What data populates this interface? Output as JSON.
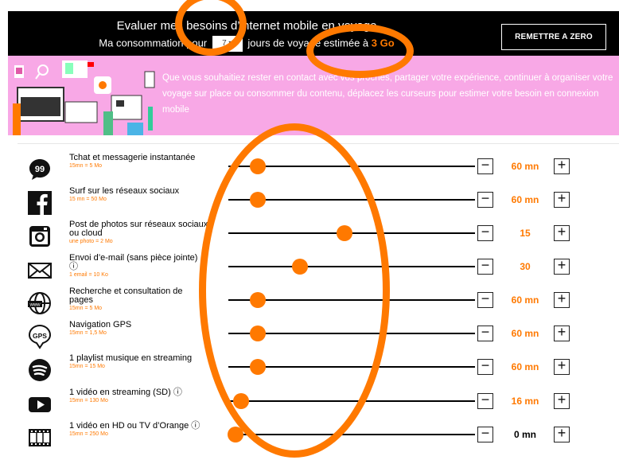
{
  "header": {
    "title": "Evaluer mes besoins d’internet mobile en voyage",
    "line_prefix": "Ma consommation pour",
    "days_value": "7",
    "line_middle": "jours de voyage estimée à",
    "total": "3 Go",
    "reset_label": "REMETTRE A ZERO"
  },
  "intro": {
    "text": "Que vous souhaitiez rester en contact avec vos proches, partager votre expérience, continuer à organiser votre voyage sur place ou consommer du contenu, déplacez les curseurs pour estimer votre besoin en connexion mobile"
  },
  "rows": [
    {
      "icon": "chat-bubble-icon",
      "label": "Tchat et messagerie instantanée",
      "sub": "15mn = 5 Mo",
      "value": "60 mn",
      "level": 0.12
    },
    {
      "icon": "facebook-icon",
      "label": "Surf sur les réseaux sociaux",
      "sub": "15 mn = 50 Mo",
      "value": "60 mn",
      "level": 0.12
    },
    {
      "icon": "instagram-icon",
      "label": "Post de photos sur réseaux sociaux ou cloud",
      "sub": "une photo = 2 Mo",
      "value": "15",
      "level": 0.47
    },
    {
      "icon": "envelope-icon",
      "label": "Envoi d’e-mail (sans pièce jointe) ⓘ",
      "sub": "1 email = 10 Ko",
      "value": "30",
      "level": 0.29
    },
    {
      "icon": "globe-www-icon",
      "label": "Recherche et consultation de pages",
      "sub": "15mn = 5 Mo",
      "value": "60 mn",
      "level": 0.12
    },
    {
      "icon": "gps-icon",
      "label": "Navigation GPS",
      "sub": "15mn = 1,5 Mo",
      "value": "60 mn",
      "level": 0.12
    },
    {
      "icon": "spotify-icon",
      "label": "1 playlist musique en streaming",
      "sub": "15mn = 15 Mo",
      "value": "60 mn",
      "level": 0.12
    },
    {
      "icon": "youtube-play-icon",
      "label": "1 vidéo en streaming (SD) ⓘ",
      "sub": "15mn = 130 Mo",
      "value": "16 mn",
      "level": 0.05
    },
    {
      "icon": "film-icon",
      "label": "1 vidéo en HD ou TV d’Orange ⓘ",
      "sub": "15mn = 250 Mo",
      "value": "0 mn",
      "level": 0.03
    }
  ],
  "controls": {
    "minus": "−",
    "plus": "+"
  },
  "colors": {
    "accent": "#ff7900",
    "header_bg": "#000000",
    "intro_bg": "#f8a8e6"
  }
}
